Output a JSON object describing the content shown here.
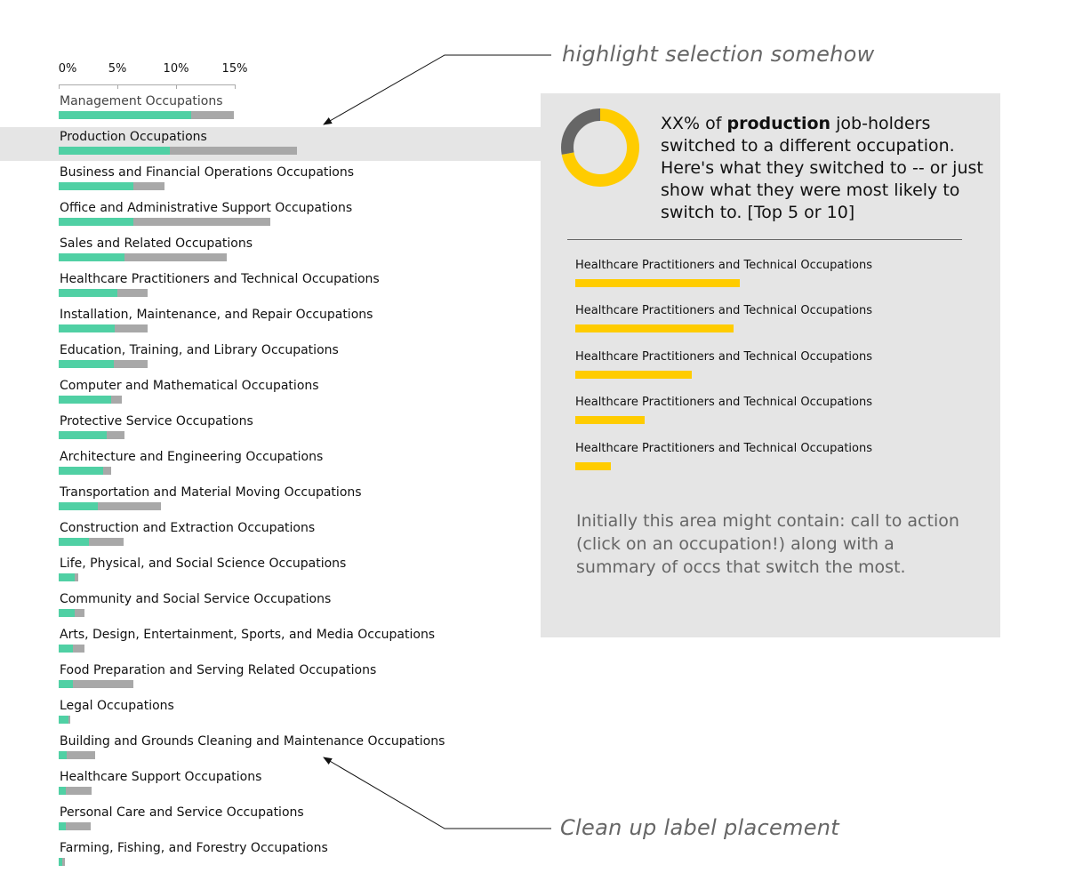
{
  "colors": {
    "series_a": "#50d0a4",
    "series_b": "#a8a8a8",
    "accent": "#ffcc00",
    "donut_rest": "#666666",
    "panel_bg": "#e5e5e5"
  },
  "chart_data": [
    {
      "type": "bar",
      "orientation": "horizontal-stacked",
      "x_ticks": [
        "0%",
        "5%",
        "10%",
        "15%"
      ],
      "xlim": [
        0,
        15
      ],
      "categories": [
        "Management Occupations",
        "Production Occupations",
        "Business and Financial Operations Occupations",
        "Office and Administrative Support Occupations",
        "Sales and Related Occupations",
        "Healthcare Practitioners and Technical Occupations",
        "Installation, Maintenance, and Repair Occupations",
        "Education, Training, and Library Occupations",
        "Computer and Mathematical Occupations",
        "Protective Service Occupations",
        "Architecture and Engineering Occupations",
        "Transportation and Material Moving Occupations",
        "Construction and Extraction Occupations",
        "Life, Physical, and Social Science Occupations",
        "Community and Social Service Occupations",
        "Arts, Design, Entertainment, Sports, and Media Occupations",
        "Food Preparation and Serving Related Occupations",
        "Legal Occupations",
        "Building and Grounds Cleaning and Maintenance Occupations",
        "Healthcare Support Occupations",
        "Personal Care and Service Occupations",
        "Farming, Fishing, and Forestry Occupations"
      ],
      "series": [
        {
          "values": [
            11.3,
            9.5,
            6.4,
            6.4,
            5.6,
            5.0,
            4.8,
            4.7,
            4.5,
            4.1,
            3.8,
            3.3,
            2.6,
            1.4,
            1.4,
            1.2,
            1.2,
            0.8,
            0.7,
            0.6,
            0.6,
            0.3
          ]
        },
        {
          "values": [
            3.6,
            10.8,
            2.6,
            11.6,
            8.7,
            2.6,
            2.8,
            2.9,
            0.9,
            1.5,
            0.7,
            5.4,
            2.9,
            0.3,
            0.8,
            1.0,
            5.2,
            0.2,
            2.4,
            2.2,
            2.1,
            0.2
          ]
        }
      ]
    },
    {
      "type": "pie",
      "style": "donut",
      "values": [
        72,
        28
      ]
    },
    {
      "type": "bar",
      "orientation": "horizontal",
      "categories": [
        "Healthcare Practitioners and Technical Occupations",
        "Healthcare Practitioners and Technical Occupations",
        "Healthcare Practitioners and Technical Occupations",
        "Healthcare Practitioners and Technical Occupations",
        "Healthcare Practitioners and Technical Occupations"
      ],
      "values": [
        185,
        178,
        131,
        78,
        40
      ]
    }
  ],
  "annotations": {
    "top": "highlight selection somehow",
    "bottom": "Clean up label placement"
  },
  "panel": {
    "summary_pre": "XX% of ",
    "summary_bold": "production",
    "summary_post": " job-holders switched to a different occupation. Here's what they switched to -- or just show what they were most likely to switch to. [Top 5 or 10]",
    "note": "Initially this area might contain: call to action (click on an occupation!) along with a summary of occs that switch the most."
  },
  "selected_index": 1
}
